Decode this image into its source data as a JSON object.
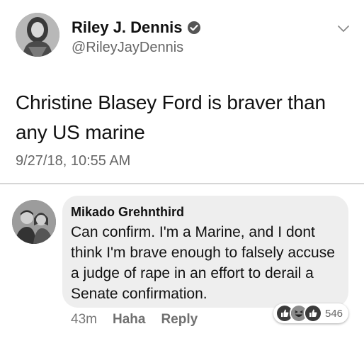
{
  "tweet": {
    "author_name": "Riley J. Dennis",
    "handle": "@RileyJayDennis",
    "text": "Christine Blasey Ford is braver than any US marine",
    "timestamp": "9/27/18, 10:55 AM",
    "verified": true
  },
  "comment": {
    "author_name": "Mikado Grehnthird",
    "text": "Can confirm. I'm a Marine, and I dont think I'm brave enough to falsely accuse a judge of rape in an effort to derail a Senate confirmation.",
    "time": "43m",
    "actions": {
      "haha": "Haha",
      "reply": "Reply"
    },
    "reaction_count": "546",
    "reaction_icons": [
      "like-icon",
      "haha-icon",
      "like-icon"
    ]
  }
}
